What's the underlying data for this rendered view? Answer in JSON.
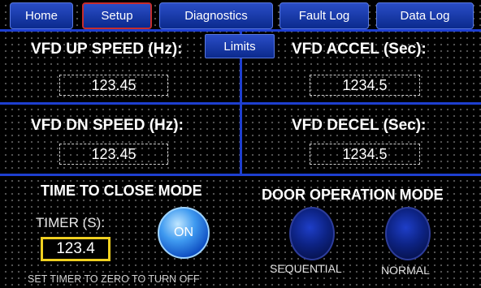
{
  "nav": {
    "tabs": [
      {
        "label": "Home"
      },
      {
        "label": "Setup",
        "active": true
      },
      {
        "label": "Diagnostics"
      },
      {
        "label": "Fault Log"
      },
      {
        "label": "Data Log"
      }
    ],
    "sub_tab": {
      "label": "Limits"
    }
  },
  "vfd": {
    "up_speed": {
      "label": "VFD UP SPEED (Hz):",
      "value": "123.45"
    },
    "accel": {
      "label": "VFD ACCEL (Sec):",
      "value": "1234.5"
    },
    "dn_speed": {
      "label": "VFD DN SPEED (Hz):",
      "value": "123.45"
    },
    "decel": {
      "label": "VFD DECEL (Sec):",
      "value": "1234.5"
    }
  },
  "time_to_close": {
    "title": "TIME TO CLOSE MODE",
    "timer_label": "TIMER (S):",
    "timer_value": "123.4",
    "toggle_label": "ON",
    "hint": "SET TIMER TO ZERO TO TURN OFF"
  },
  "door_operation": {
    "title": "DOOR OPERATION MODE",
    "modes": [
      {
        "label": "SEQUENTIAL"
      },
      {
        "label": "NORMAL"
      }
    ]
  },
  "colors": {
    "grid_lines": "#1e3fd0",
    "tab_fill": "#0b2a8d",
    "active_tab_border": "#c62d2d",
    "timer_border": "#f0d020",
    "on_button": "#3f9af0"
  }
}
